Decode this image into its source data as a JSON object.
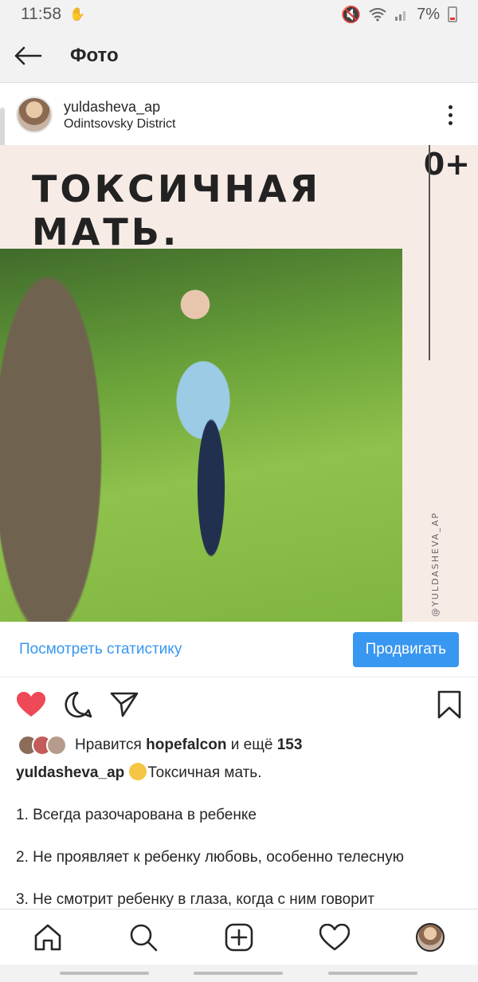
{
  "status": {
    "time": "11:58",
    "battery": "7%"
  },
  "header": {
    "title": "Фото"
  },
  "post": {
    "username": "yuldasheva_ap",
    "location": "Odintsovsky District",
    "image": {
      "headline": "ТОКСИЧНАЯ МАТЬ.",
      "age_rating": "0+",
      "watermark": "@YULDASHEVA_AP"
    },
    "stats_link": "Посмотреть статистику",
    "promote_label": "Продвигать",
    "likes": {
      "prefix": "Нравится",
      "user": "hopefalcon",
      "middle": "и ещё",
      "count": "153"
    },
    "caption": {
      "username": "yuldasheva_ap",
      "text": "Токсичная мать.",
      "items": [
        "1. Всегда разочарована в ребенке",
        "2. Не проявляет к ребенку любовь, особенно телесную",
        "3. Не смотрит ребенку в глаза, когда с ним говорит"
      ]
    }
  },
  "colors": {
    "accent": "#3897f0",
    "like": "#ed4956",
    "text": "#262626"
  }
}
